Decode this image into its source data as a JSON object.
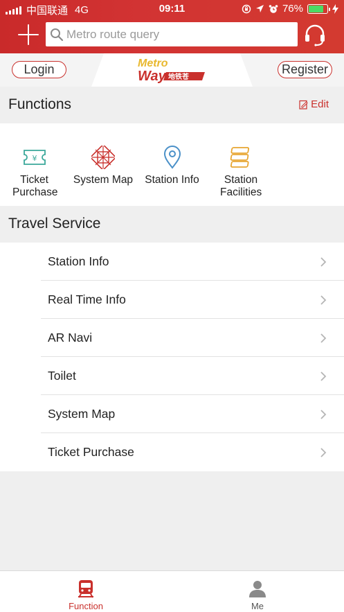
{
  "status_bar": {
    "carrier": "中国联通",
    "network": "4G",
    "time": "09:11",
    "battery_percent": "76%",
    "battery_level": 0.76
  },
  "header": {
    "search_placeholder": "Metro route query",
    "plus_icon": "plus-icon",
    "support_icon": "headset-icon"
  },
  "auth": {
    "login_label": "Login",
    "register_label": "Register",
    "logo_line1": "Metro",
    "logo_line2": "Way",
    "logo_cn": "地铁苍"
  },
  "functions": {
    "title": "Functions",
    "edit_label": "Edit",
    "items": [
      {
        "label": "Ticket Purchase",
        "icon": "ticket-icon"
      },
      {
        "label": "System Map",
        "icon": "network-map-icon"
      },
      {
        "label": "Station Info",
        "icon": "location-pin-icon"
      },
      {
        "label": "Station Facilities",
        "icon": "stacked-layers-icon"
      }
    ]
  },
  "travel_service": {
    "title": "Travel Service",
    "items": [
      {
        "label": "Station Info"
      },
      {
        "label": "Real Time Info"
      },
      {
        "label": "AR Navi"
      },
      {
        "label": "Toilet"
      },
      {
        "label": "System Map"
      },
      {
        "label": "Ticket Purchase"
      }
    ]
  },
  "tabbar": {
    "tabs": [
      {
        "label": "Function",
        "icon": "train-icon",
        "active": true
      },
      {
        "label": "Me",
        "icon": "person-icon",
        "active": false
      }
    ]
  },
  "colors": {
    "brand_red": "#c9302c",
    "icon_teal": "#3aa89a",
    "icon_red": "#c9302c",
    "icon_blue": "#4a90c8",
    "icon_orange": "#e8a530",
    "inactive_gray": "#8a8a8a"
  }
}
